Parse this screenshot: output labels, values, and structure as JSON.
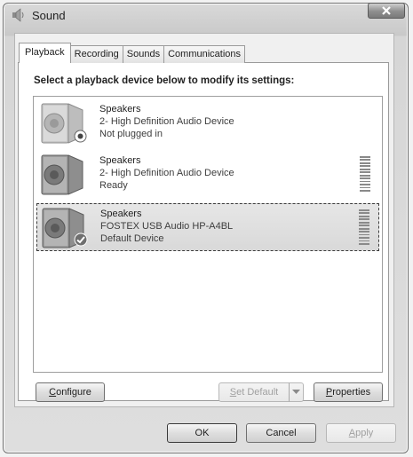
{
  "window": {
    "title": "Sound"
  },
  "tabs": [
    {
      "label": "Playback",
      "active": true
    },
    {
      "label": "Recording",
      "active": false
    },
    {
      "label": "Sounds",
      "active": false
    },
    {
      "label": "Communications",
      "active": false
    }
  ],
  "instruction": "Select a playback device below to modify its settings:",
  "devices": [
    {
      "name": "Speakers",
      "description": "2- High Definition Audio Device",
      "status": "Not plugged in",
      "badge": "unplugged-icon",
      "selected": false
    },
    {
      "name": "Speakers",
      "description": "2- High Definition Audio Device",
      "status": "Ready",
      "badge": null,
      "selected": false
    },
    {
      "name": "Speakers",
      "description": "FOSTEX USB Audio HP-A4BL",
      "status": "Default Device",
      "badge": "default-check-icon",
      "selected": true
    }
  ],
  "buttons": {
    "configure": {
      "prefix": "C",
      "rest": "onfigure"
    },
    "set_default": {
      "prefix": "S",
      "rest": "et Default"
    },
    "properties": {
      "prefix": "P",
      "rest": "roperties"
    },
    "ok": "OK",
    "cancel": "Cancel",
    "apply": {
      "prefix": "A",
      "rest": "pply"
    }
  },
  "colors": {
    "check_green": "#3d9a2e",
    "selection_border": "#3a3a3a"
  }
}
